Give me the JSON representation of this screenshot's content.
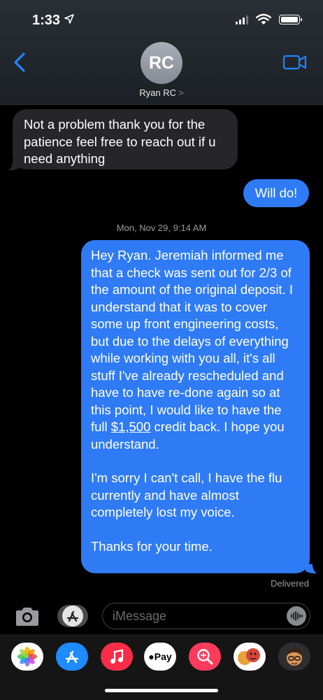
{
  "status": {
    "time": "1:33"
  },
  "header": {
    "avatar_initials": "RC",
    "contact_name": "Ryan RC",
    "chevron": ">"
  },
  "messages": {
    "m1": "Not a problem thank you for the patience feel free to reach out if u need anything",
    "m2": "Will do!",
    "timestamp": "Mon, Nov 29, 9:14 AM",
    "m3": {
      "p1a": "Hey Ryan. Jeremiah informed me that a check was sent out for 2/3 of the amount of the original deposit. I understand that it was to cover some up front engineering costs, but due to the delays of everything while working with you all, it's all stuff I've already rescheduled and have to have re-done again so at this point, I would like to have the full ",
      "p1_link": "$1,500",
      "p1b": " credit back. I hope you understand.",
      "p2": "I'm sorry I can't call, I have the flu currently and have almost completely lost my voice.",
      "p3": "Thanks for your time."
    },
    "delivered": "Delivered"
  },
  "input": {
    "placeholder": "iMessage"
  },
  "tray": {
    "applepay_label": "Pay"
  },
  "colors": {
    "outgoing": "#2f7bf5",
    "incoming": "#262628",
    "accent": "#1f86ff"
  }
}
